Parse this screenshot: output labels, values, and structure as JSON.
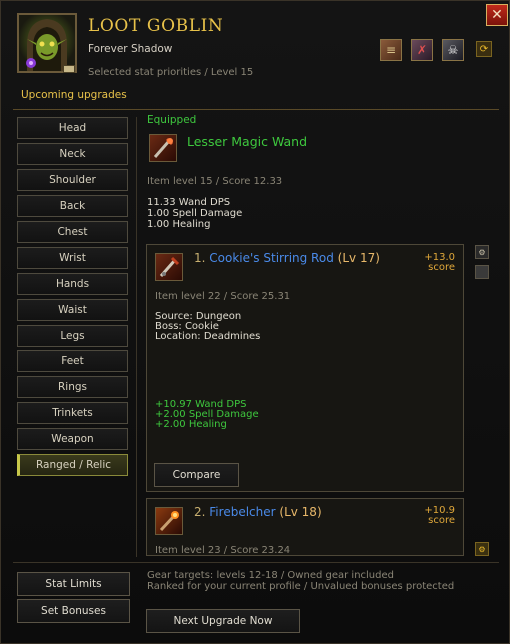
{
  "window": {
    "title": "LOOT GOBLIN",
    "subtitle": "Forever Shadow",
    "note": "Selected stat priorities / Level 15",
    "close_label": "✕"
  },
  "header_icons": [
    {
      "name": "scroll-icon",
      "glyph": "≡"
    },
    {
      "name": "tool-icon",
      "glyph": "✗"
    },
    {
      "name": "skull-icon",
      "glyph": "☠"
    },
    {
      "name": "cycle-icon",
      "glyph": "⟳"
    }
  ],
  "section": {
    "label": "Upcoming upgrades"
  },
  "slots": [
    {
      "label": "Head"
    },
    {
      "label": "Neck"
    },
    {
      "label": "Shoulder"
    },
    {
      "label": "Back"
    },
    {
      "label": "Chest"
    },
    {
      "label": "Wrist"
    },
    {
      "label": "Hands"
    },
    {
      "label": "Waist"
    },
    {
      "label": "Legs"
    },
    {
      "label": "Feet"
    },
    {
      "label": "Rings"
    },
    {
      "label": "Trinkets"
    },
    {
      "label": "Weapon"
    },
    {
      "label": "Ranged / Relic"
    }
  ],
  "active_slot": "Ranged / Relic",
  "equipped": {
    "label": "Equipped",
    "name": "Lesser Magic Wand",
    "meta": "Item level 15 / Score 12.33",
    "stats": [
      "11.33 Wand DPS",
      "1.00 Spell Damage",
      "1.00 Healing"
    ]
  },
  "upgrades": [
    {
      "rank": "1.",
      "name": "Cookie's Stirring Rod",
      "level": "(Lv 17)",
      "score": "+13.0",
      "score_unit": "score",
      "meta": "Item level 22 / Score 25.31",
      "source": [
        "Source: Dungeon",
        "Boss: Cookie",
        "Location: Deadmines"
      ],
      "gains": [
        "+10.97 Wand DPS",
        "+2.00 Spell Damage",
        "+2.00 Healing"
      ],
      "compare_label": "Compare"
    },
    {
      "rank": "2.",
      "name": "Firebelcher",
      "level": "(Lv 18)",
      "score": "+10.9",
      "score_unit": "score",
      "meta": "Item level 23 / Score 23.24"
    }
  ],
  "side_buttons": [
    {
      "name": "gear-icon",
      "glyph": "⚙"
    },
    {
      "name": "square-icon",
      "glyph": ""
    },
    {
      "name": "gear-icon-gold",
      "glyph": "⚙"
    }
  ],
  "footer": {
    "stat_limits_label": "Stat Limits",
    "set_bonuses_label": "Set Bonuses",
    "note_line1": "Gear targets: levels 12-18 / Owned gear included",
    "note_line2": "Ranked for your current profile / Unvalued bonuses protected",
    "next_upgrade_label": "Next Upgrade Now"
  },
  "colors": {
    "title": "#e8c24a",
    "equipped_green": "#3ec83e",
    "item_blue": "#4a8ae8",
    "score_orange": "#e0a83a",
    "close_red": "#c02a1a"
  }
}
